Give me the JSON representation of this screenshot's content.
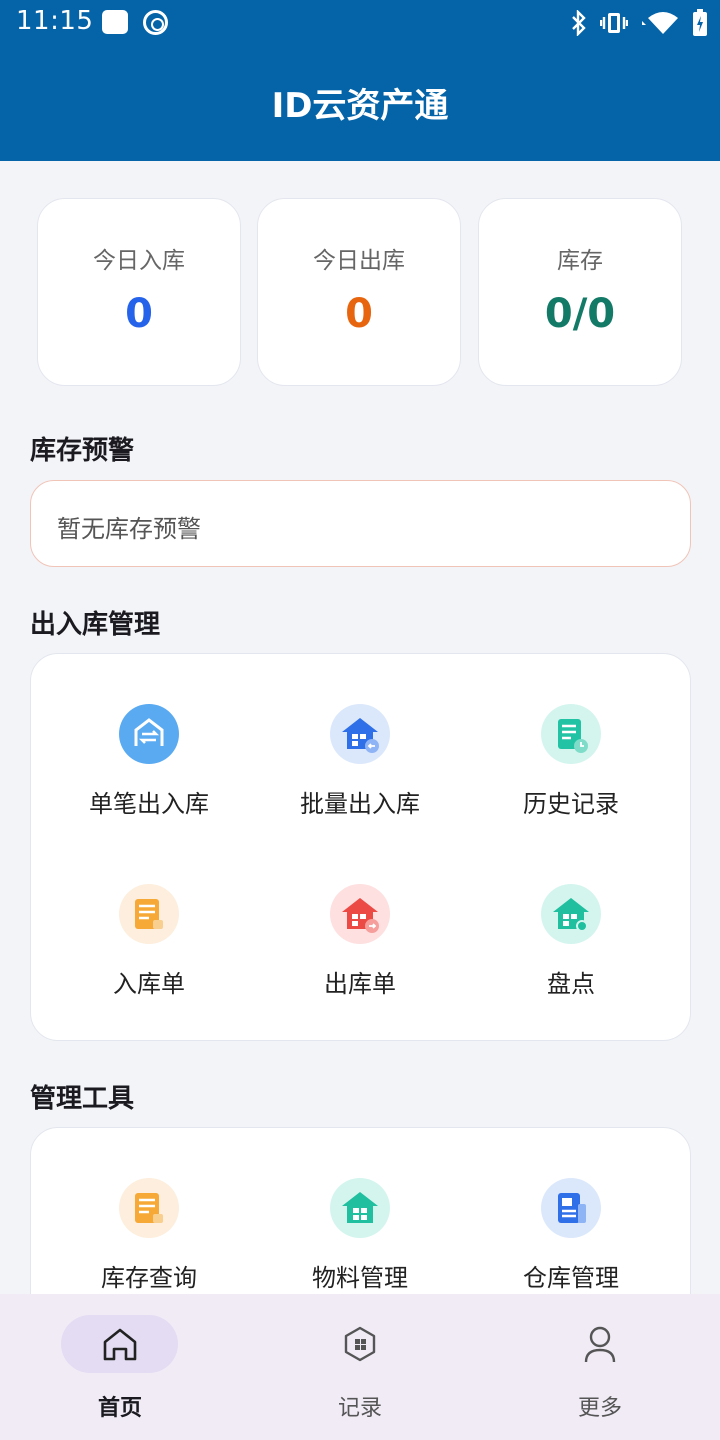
{
  "status_bar": {
    "time": "11:15"
  },
  "header": {
    "title": "ID云资产通"
  },
  "stats": [
    {
      "label": "今日入库",
      "value": "0",
      "color": "#2563eb"
    },
    {
      "label": "今日出库",
      "value": "0",
      "color": "#e8650f"
    },
    {
      "label": "库存",
      "value": "0/0",
      "color": "#137a67"
    }
  ],
  "alert_section": {
    "title": "库存预警",
    "empty_text": "暂无库存预警"
  },
  "inout_section": {
    "title": "出入库管理",
    "items": [
      {
        "label": "单笔出入库",
        "icon": "warehouse-exchange-icon"
      },
      {
        "label": "批量出入库",
        "icon": "warehouse-batch-icon"
      },
      {
        "label": "历史记录",
        "icon": "history-document-icon"
      },
      {
        "label": "入库单",
        "icon": "inbound-document-icon"
      },
      {
        "label": "出库单",
        "icon": "outbound-warehouse-icon"
      },
      {
        "label": "盘点",
        "icon": "inventory-check-icon"
      }
    ]
  },
  "tools_section": {
    "title": "管理工具",
    "items": [
      {
        "label": "库存查询",
        "icon": "stock-query-icon"
      },
      {
        "label": "物料管理",
        "icon": "material-warehouse-icon"
      },
      {
        "label": "仓库管理",
        "icon": "warehouse-document-icon"
      }
    ]
  },
  "bottom_nav": [
    {
      "label": "首页",
      "icon": "home-icon",
      "active": true
    },
    {
      "label": "记录",
      "icon": "records-icon",
      "active": false
    },
    {
      "label": "更多",
      "icon": "profile-icon",
      "active": false
    }
  ]
}
